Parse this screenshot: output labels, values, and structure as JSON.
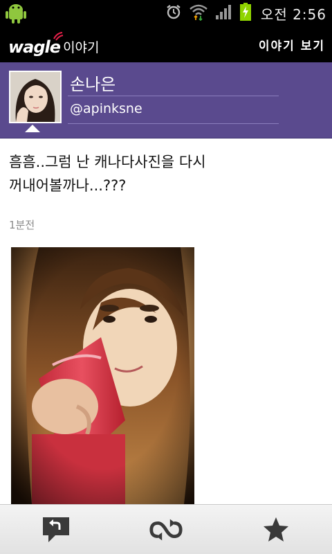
{
  "status_bar": {
    "time": "오전 2:56",
    "icons": [
      "android-icon",
      "alarm-icon",
      "wifi-icon",
      "signal-icon",
      "battery-charging-icon"
    ]
  },
  "app_bar": {
    "logo_text": "wagle",
    "logo_subtitle": "이야기",
    "view_story_button": "이야기 보기"
  },
  "profile": {
    "name": "손나은",
    "handle": "@apinksne"
  },
  "post": {
    "text_line1": "흠흠..그럼 난 캐나다사진을 다시",
    "text_line2": "꺼내어볼까나...???",
    "time_ago": "1분전"
  },
  "toolbar": {
    "icons": [
      "reply-icon",
      "retweet-icon",
      "star-icon"
    ]
  },
  "colors": {
    "profile_bg": "#5a4a8e",
    "status_bg": "#000000",
    "logo_accent": "#e8204a"
  }
}
